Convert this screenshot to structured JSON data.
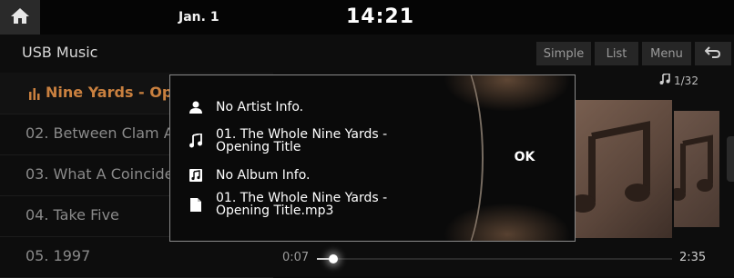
{
  "status": {
    "date": "Jan. 1",
    "time": "14:21"
  },
  "header": {
    "title": "USB Music",
    "buttons": {
      "simple": "Simple",
      "list": "List",
      "menu": "Menu"
    }
  },
  "tracks": [
    {
      "label": "Nine Yards - Ope",
      "playing": true
    },
    {
      "label": "02. Between Clam A"
    },
    {
      "label": "03. What A Coincide"
    },
    {
      "label": "04. Take Five"
    },
    {
      "label": "05. 1997"
    }
  ],
  "player": {
    "counter": "1/32",
    "elapsed": "0:07",
    "total": "2:35",
    "progress_fraction": 0.045
  },
  "dialog": {
    "artist": "No Artist Info.",
    "title": "01. The Whole Nine Yards - Opening Title",
    "album": "No Album Info.",
    "file": "01. The Whole Nine Yards - Opening Title.mp3",
    "ok_label": "OK"
  },
  "colors": {
    "accent": "#c9803f",
    "background": "#0d0d0d"
  }
}
